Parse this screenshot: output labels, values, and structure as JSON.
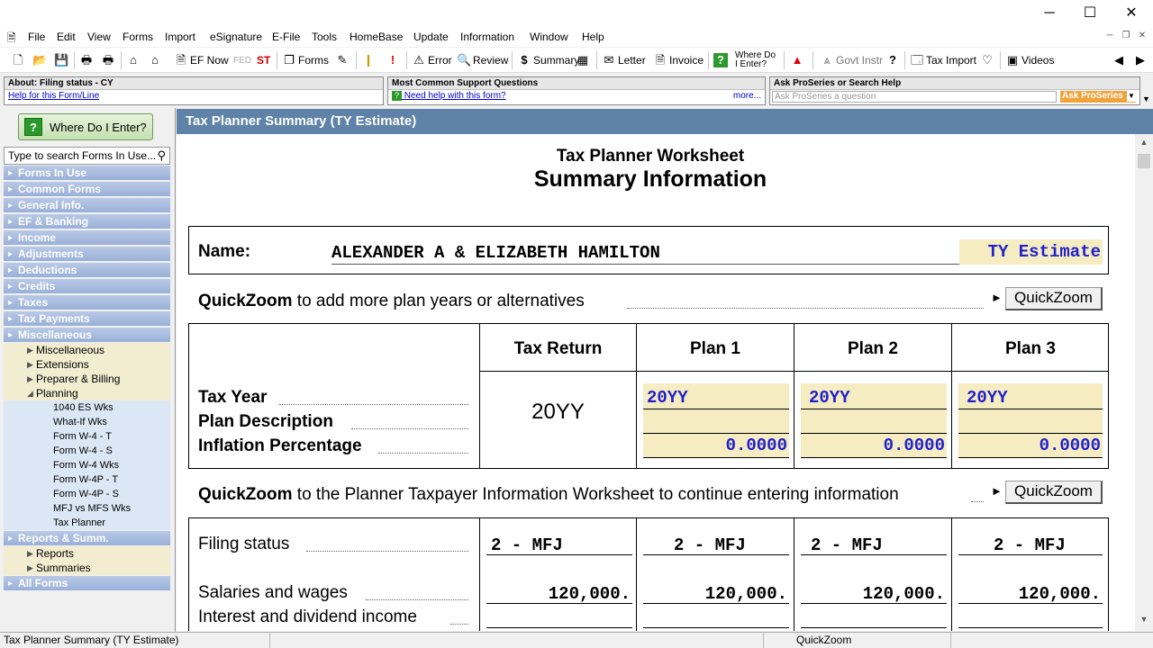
{
  "window": {
    "minimize": "─",
    "maximize": "☐",
    "close": "✕"
  },
  "menu": [
    "File",
    "Edit",
    "View",
    "Forms",
    "Import",
    "eSignature",
    "E-File",
    "Tools",
    "HomeBase",
    "Update",
    "Information",
    "Window",
    "Help"
  ],
  "toolbar": {
    "ef_now": "EF Now",
    "fed": "FED",
    "st": "ST",
    "forms": "Forms",
    "error": "Error",
    "review": "Review",
    "summary": "Summary",
    "letter": "Letter",
    "invoice": "Invoice",
    "where_do_i_enter_1": "Where Do",
    "where_do_i_enter_2": "I Enter?",
    "govt_instr": "Govt Instr",
    "tax_import": "Tax Import",
    "videos": "Videos"
  },
  "help": {
    "about_title": "About: Filing status - CY",
    "about_link": "Help for this Form/Line",
    "support_title": "Most Common Support Questions",
    "support_link": "Need help with this form?",
    "support_more": "more...",
    "ask_title": "Ask ProSeries or Search Help",
    "ask_placeholder": "Ask ProSeries a question",
    "ask_button": "Ask ProSeries"
  },
  "sidebar": {
    "where_do_i_enter": "Where Do I Enter?",
    "search_placeholder": "Type to search Forms In Use...",
    "sections": [
      "Forms In Use",
      "Common Forms",
      "General Info.",
      "EF & Banking",
      "Income",
      "Adjustments",
      "Deductions",
      "Credits",
      "Taxes",
      "Tax Payments",
      "Miscellaneous"
    ],
    "misc_subs": [
      "Miscellaneous",
      "Extensions",
      "Preparer & Billing",
      "Planning"
    ],
    "planning_leaves": [
      "1040 ES Wks",
      "What-If Wks",
      "Form W-4 - T",
      "Form W-4 - S",
      "Form W-4  Wks",
      "Form W-4P - T",
      "Form W-4P - S",
      "MFJ vs MFS Wks",
      "Tax Planner"
    ],
    "reports_section": "Reports & Summ.",
    "reports_subs": [
      "Reports",
      "Summaries"
    ],
    "all_forms": "All Forms"
  },
  "main": {
    "header": "Tax Planner Summary (TY Estimate)",
    "title1": "Tax Planner Worksheet",
    "title2": "Summary Information",
    "name_label": "Name:",
    "name_value": "ALEXANDER A & ELIZABETH HAMILTON",
    "ty_estimate": "TY Estimate",
    "qz1_bold": "QuickZoom",
    "qz1_text": " to add more plan years or alternatives",
    "qz_button": "QuickZoom",
    "qz2_bold": "QuickZoom",
    "qz2_text": " to the Planner Taxpayer Information Worksheet to continue entering information",
    "columns": [
      "Tax Return",
      "Plan 1",
      "Plan 2",
      "Plan 3"
    ],
    "row_labels": {
      "tax_year": "Tax Year",
      "plan_description": "Plan Description",
      "inflation": "Inflation Percentage"
    },
    "tax_return_year": "20YY",
    "plans": [
      {
        "year": "20YY",
        "inflation": "0.0000"
      },
      {
        "year": "20YY",
        "inflation": "0.0000"
      },
      {
        "year": "20YY",
        "inflation": "0.0000"
      }
    ],
    "filing_status_label": "Filing status",
    "filing_status_values": [
      "2 - MFJ",
      "2 - MFJ",
      "2 - MFJ",
      "2 - MFJ"
    ],
    "salaries_label": "Salaries and wages",
    "salaries_values": [
      "120,000.",
      "120,000.",
      "120,000.",
      "120,000."
    ],
    "interest_label": "Interest and dividend income"
  },
  "status": {
    "left": "Tax Planner Summary (TY Estimate)",
    "middle": "QuickZoom"
  }
}
